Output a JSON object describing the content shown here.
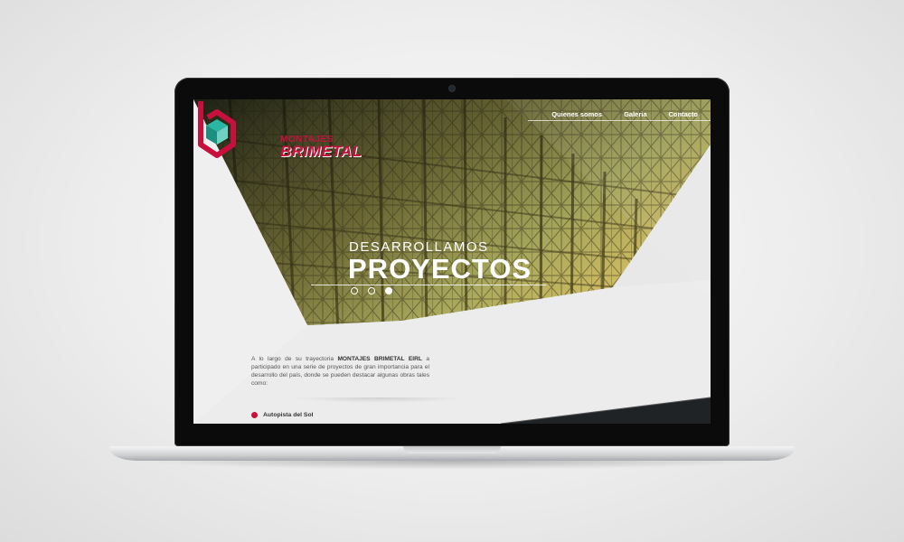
{
  "site": {
    "logo": {
      "line1": "MONTAJES",
      "line2": "BRIMETAL"
    },
    "nav": {
      "items": [
        "Quienes somos",
        "Galeria",
        "Contacto"
      ]
    },
    "hero": {
      "kicker": "DESARROLLAMOS",
      "headline": "PROYECTOS",
      "slides": {
        "count": 3,
        "active_index": 2
      }
    },
    "intro": {
      "text_before": "A lo largo de su trayectoria ",
      "company": "MONTAJES BRIMETAL EIRL",
      "text_after": " a participado en una serie de proyectos de gran importancia para el desarrollo del país, donde se pueden destacar algunas obras tales como:"
    },
    "projects": [
      {
        "label": "Autopista del Sol"
      }
    ]
  },
  "colors": {
    "brand_red": "#c8103e",
    "hero_overlay": "#8a8f3a",
    "background": "#ececec"
  },
  "icons": {
    "logo_mark": "hexagon-cube-icon",
    "bullet": "circle-bullet-icon"
  }
}
